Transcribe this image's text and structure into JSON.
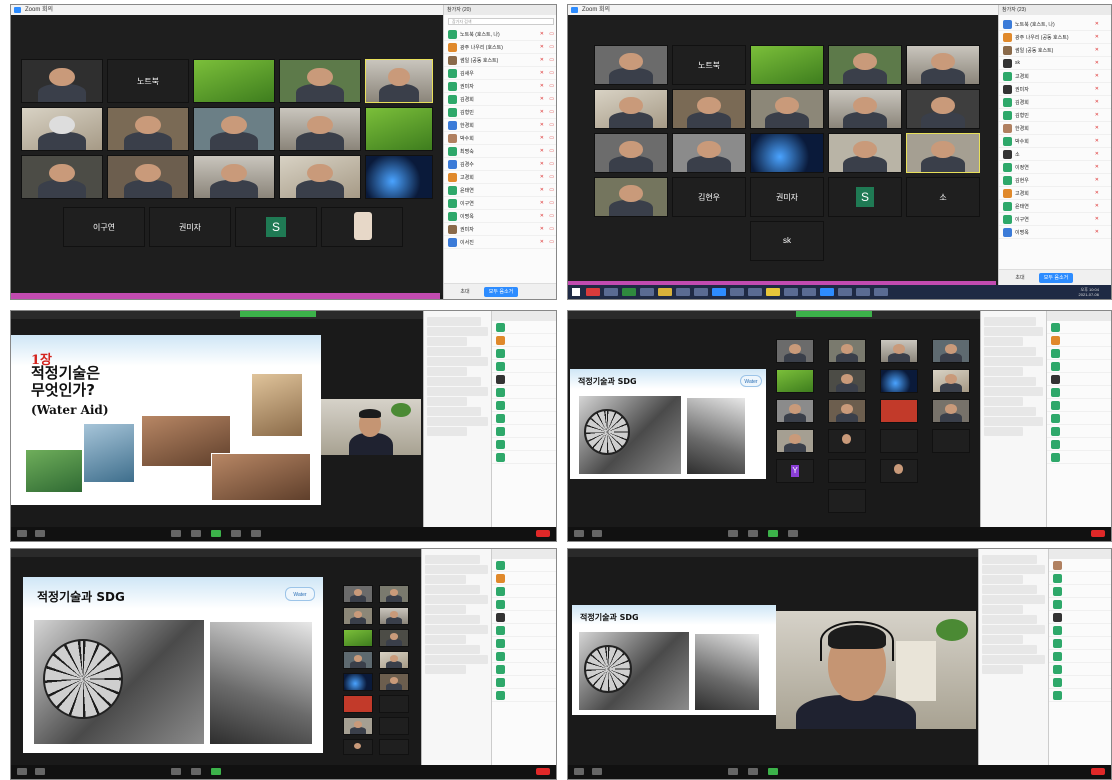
{
  "screenshots": [
    {
      "window_title": "Zoom 회의",
      "panel_title": "참가자 (20)",
      "search_placeholder": "참가자 검색",
      "tiles": [
        "노트북",
        "이구연",
        "권미자",
        "S"
      ],
      "participants": [
        "노트북 (호스트, 나)",
        "광주 나우리 (호스트)",
        "썸일 (공동 호스트)",
        "김새우",
        "권미자",
        "김경희",
        "김형민",
        "한경희",
        "박수희",
        "최명숙",
        "김경수",
        "고경희",
        "윤태연",
        "이구연",
        "이명옥",
        "권미자",
        "이서진"
      ],
      "footer": {
        "invite": "초대",
        "unmute": "모두 음소거"
      }
    },
    {
      "window_title": "Zoom 회의",
      "panel_title": "참가자 (23)",
      "tiles": [
        "노트북",
        "김현우",
        "권미자",
        "S",
        "소",
        "sk"
      ],
      "participants": [
        "노트북 (호스트, 나)",
        "광주 나우리 (공동 호스트)",
        "썸일 (공동 호스트)",
        "sk",
        "고경희",
        "권미자",
        "김경희",
        "김형민",
        "한경희",
        "박수희",
        "소",
        "이정연",
        "김현우",
        "고경희",
        "윤태연",
        "이구연",
        "이명옥"
      ],
      "footer": {
        "invite": "초대",
        "unmute": "모두 음소거"
      },
      "clock": {
        "time": "오후 10:04",
        "date": "2021-07-06"
      }
    },
    {
      "slide": {
        "chapter": "1장",
        "title_line1": "적정기술은",
        "title_line2": "무엇인가?",
        "subtitle": "(Water Aid)"
      }
    },
    {
      "slide": {
        "title": "적정기술과 SDG",
        "logo": "Water"
      },
      "tiles": [
        "Y"
      ]
    },
    {
      "slide": {
        "title": "적정기술과 SDG",
        "logo": "Water"
      }
    },
    {
      "slide": {
        "title": "적정기술과 SDG"
      }
    }
  ]
}
